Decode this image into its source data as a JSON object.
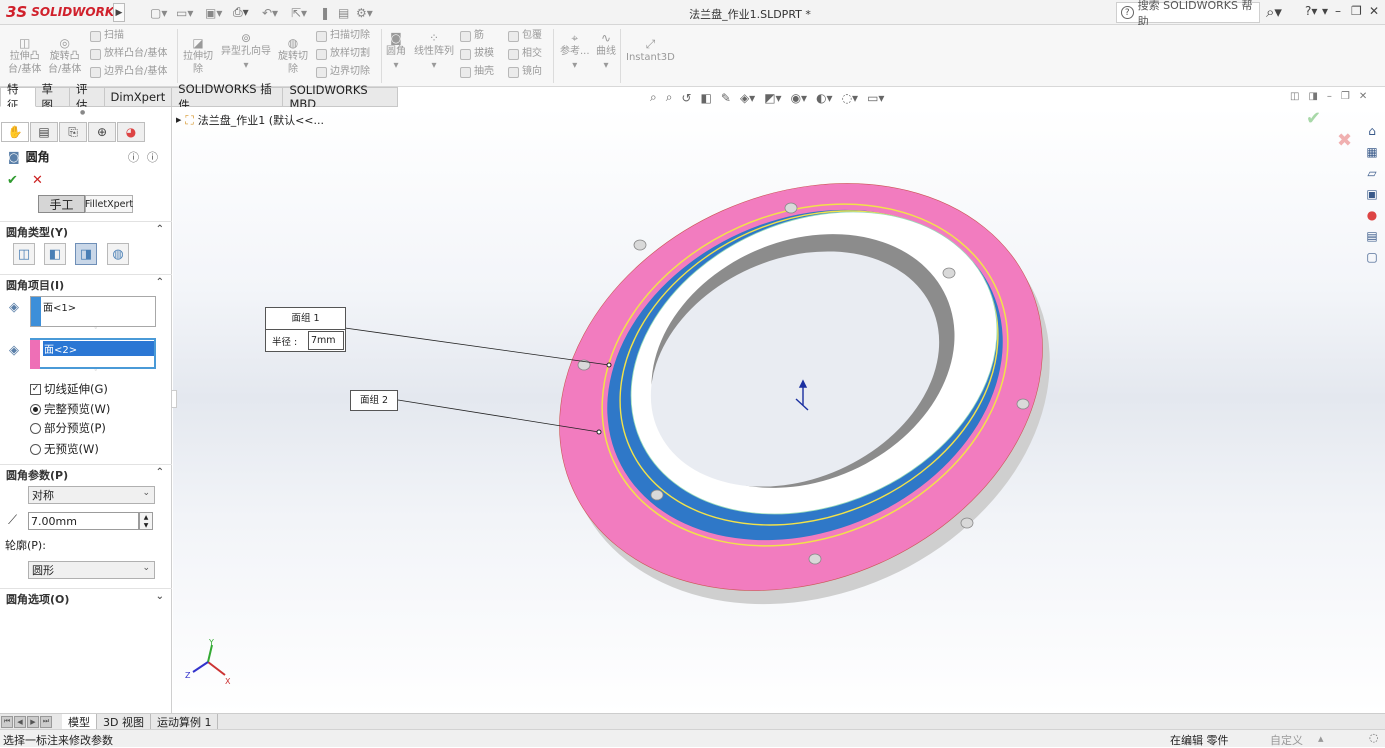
{
  "app": {
    "logo_ds": "3S",
    "logo_text": "SOLIDWORKS",
    "doc_title": "法兰盘_作业1.SLDPRT *",
    "search_placeholder": "搜索 SOLIDWORKS 帮助",
    "help_label": "?",
    "icons": [
      "new-file-icon",
      "open-icon",
      "save-icon",
      "print-icon",
      "undo-icon",
      "select-icon",
      "rebuild-icon",
      "file-props-icon",
      "options-icon"
    ]
  },
  "ribbon": {
    "extrude_boss": [
      "拉伸凸",
      "台/基体"
    ],
    "revolve_boss": [
      "旋转凸",
      "台/基体"
    ],
    "sweep": "扫描",
    "loft": "放样凸台/基体",
    "boundary": "边界凸台/基体",
    "extrude_cut": [
      "拉伸切",
      "除"
    ],
    "hole_wizard": "异型孔向导",
    "revolve_cut": [
      "旋转切",
      "除"
    ],
    "swept_cut": "扫描切除",
    "lofted_cut": "放样切割",
    "boundary_cut": "边界切除",
    "fillet": "圆角",
    "linear_pattern": "线性阵列",
    "rib": "筋",
    "draft": "拔模",
    "shell": "抽壳",
    "wrap": "包覆",
    "intersect": "相交",
    "mirror": "镜向",
    "reference": "参考...",
    "curves": "曲线",
    "instant3d": "Instant3D"
  },
  "tabs": [
    "特征",
    "草图",
    "评估",
    "DimXpert",
    "SOLIDWORKS 插件",
    "SOLIDWORKS MBD"
  ],
  "property_manager": {
    "title": "圆角",
    "btn_manual": "手工",
    "btn_filletxpert": "FilletXpert",
    "sec_type": "圆角类型(Y)",
    "sec_items": "圆角项目(I)",
    "item1": "面<1>",
    "item2": "面<2>",
    "item1_color": "#3d8fd9",
    "item2_color": "#ee6fb6",
    "tangent": "切线延伸(G)",
    "full_preview": "完整预览(W)",
    "partial_preview": "部分预览(P)",
    "no_preview": "无预览(W)",
    "sec_params": "圆角参数(P)",
    "symmetric": "对称",
    "radius": "7.00mm",
    "profile_label": "轮廓(P):",
    "profile": "圆形",
    "sec_options": "圆角选项(O)"
  },
  "viewport": {
    "tree_root": "法兰盘_作业1 (默认<<...",
    "callout1_title": "面组 1",
    "callout1_label": "半径 :",
    "callout1_value": "7mm",
    "callout2_title": "面组 2",
    "triad_x": "X",
    "triad_y": "Y",
    "triad_z": "Z",
    "face_pink": "#f27cbf",
    "face_blue": "#3f8ad6",
    "preview_yellow": "#f2e24a"
  },
  "bottom_tabs": [
    "模型",
    "3D 视图",
    "运动算例 1"
  ],
  "status": {
    "left": "选择一标注来修改参数",
    "mode": "在编辑 零件",
    "custom": "自定义"
  }
}
